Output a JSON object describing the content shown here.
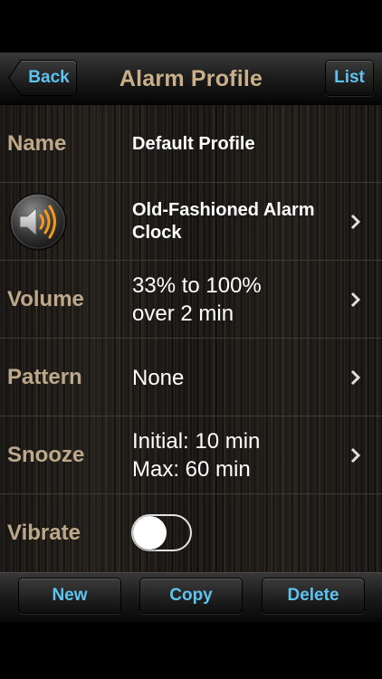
{
  "nav": {
    "title": "Alarm Profile",
    "back_label": "Back",
    "list_label": "List"
  },
  "rows": {
    "name": {
      "label": "Name",
      "value": "Default Profile"
    },
    "sound": {
      "icon": "speaker-icon",
      "value_line1": "Old-Fashioned Alarm",
      "value_line2": "Clock"
    },
    "volume": {
      "label": "Volume",
      "value_line1": "33% to 100%",
      "value_line2": "over 2 min"
    },
    "pattern": {
      "label": "Pattern",
      "value": "None"
    },
    "snooze": {
      "label": "Snooze",
      "value_line1": "Initial: 10 min",
      "value_line2": "Max: 60 min"
    },
    "vibrate": {
      "label": "Vibrate",
      "on": false
    }
  },
  "toolbar": {
    "new_label": "New",
    "copy_label": "Copy",
    "delete_label": "Delete"
  },
  "colors": {
    "accent_blue": "#5ec3ee",
    "label_tan": "#bda98a",
    "title_tan": "#c9b08a",
    "speaker_orange": "#f39a1c"
  }
}
